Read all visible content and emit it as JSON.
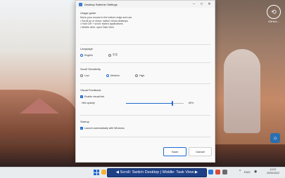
{
  "desktop": {
    "icon_label": "GitHub...",
    "widget_icon": "widget-icon"
  },
  "dialog": {
    "title": "Desktop Switcher Settings",
    "usage_guide": {
      "title": "Usage guide",
      "lines": [
        "Move your mouse to the bottom edge and use",
        "• Scroll up or down: switch virtual desktops",
        "• Hold Ctrl + scroll: switch applications",
        "• Middle click: open Task View"
      ]
    },
    "language": {
      "title": "Language",
      "options": [
        "English",
        "中文"
      ],
      "selected": "English"
    },
    "scroll_sensitivity": {
      "title": "Scroll Sensitivity",
      "options": [
        "Low",
        "Medium",
        "High"
      ],
      "selected": "Medium"
    },
    "visual_feedback": {
      "title": "Visual Feedback",
      "enable_label": "Enable visual hint",
      "enabled": true,
      "opacity_label": "Hint opacity",
      "opacity_value": "80%",
      "opacity_fraction": 0.8
    },
    "startup": {
      "title": "Startup",
      "launch_label": "Launch automatically with Windows",
      "enabled": true
    },
    "buttons": {
      "save": "Save",
      "cancel": "Cancel"
    },
    "controls": {
      "minimize": "–",
      "maximize": "□",
      "close": "✕"
    }
  },
  "taskbar": {
    "hint": "◀ Scroll: Switch Desktop | Middle: Task View ▶",
    "tray": {
      "chevron": "^",
      "lang": "ENG",
      "time": "13:57",
      "date": "2025/10/22"
    }
  },
  "colors": {
    "accent": "#1e6ad1",
    "hint_bg": "#1d3f86"
  }
}
